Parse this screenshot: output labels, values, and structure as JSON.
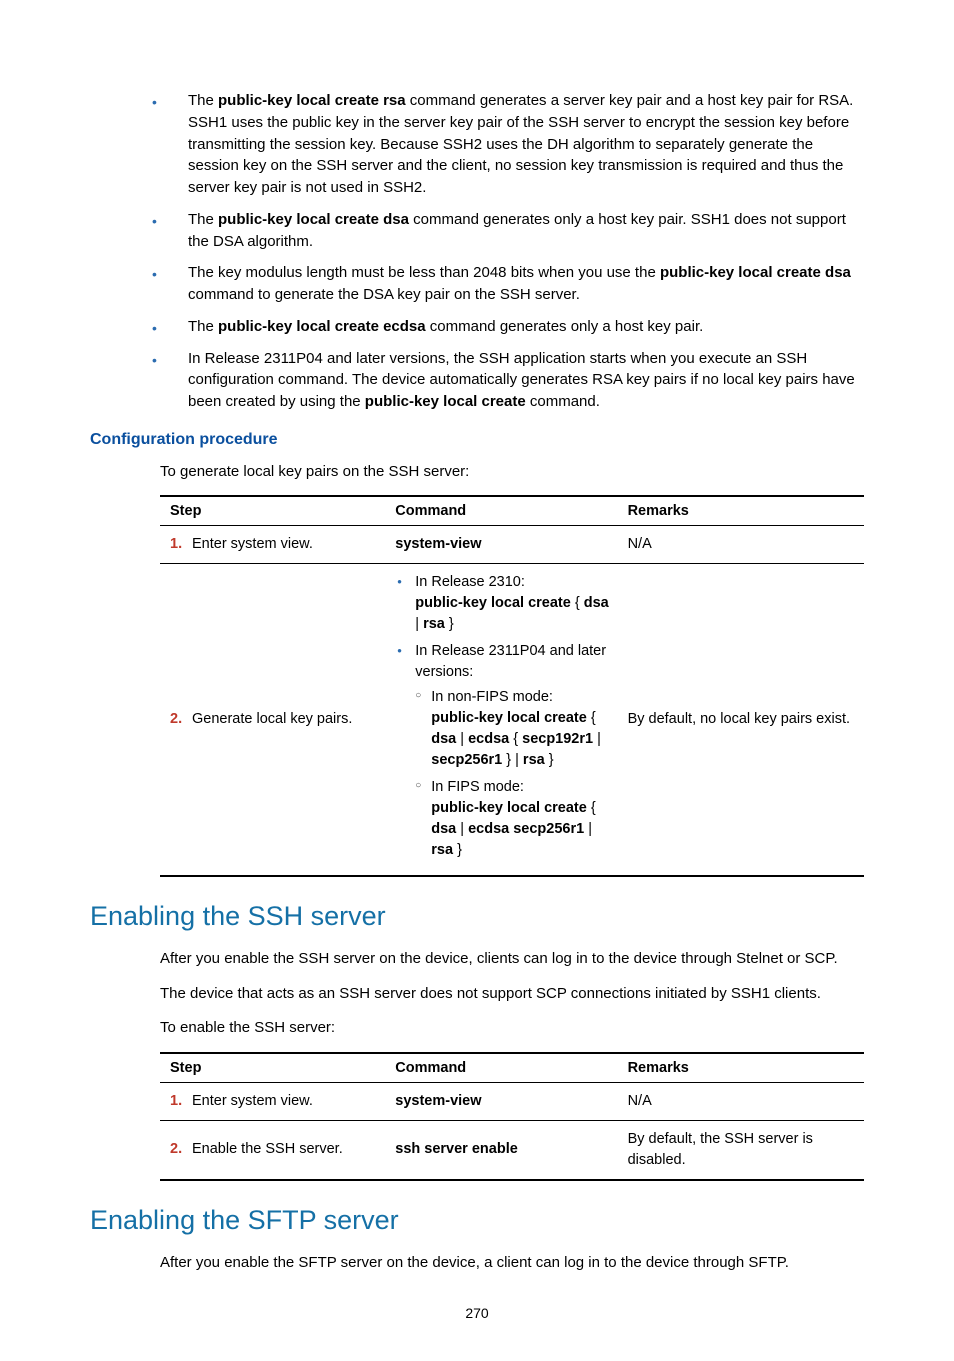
{
  "bullets": [
    {
      "pre": "The ",
      "bold": "public-key local create rsa",
      "post": " command generates a server key pair and a host key pair for RSA. SSH1 uses the public key in the server key pair of the SSH server to encrypt the session key before transmitting the session key. Because SSH2 uses the DH algorithm to separately generate the session key on the SSH server and the client, no session key transmission is required and thus the server key pair is not used in SSH2."
    },
    {
      "pre": "The ",
      "bold": "public-key local create dsa",
      "post": " command generates only a host key pair. SSH1 does not support the DSA algorithm."
    },
    {
      "pre": "The key modulus length must be less than 2048 bits when you use the ",
      "bold": "public-key local create dsa",
      "post": " command to generate the DSA key pair on the SSH server."
    },
    {
      "pre": "The ",
      "bold": "public-key local create ecdsa",
      "post": " command generates only a host key pair."
    },
    {
      "pre": "In Release 2311P04 and later versions, the SSH application starts when you execute an SSH configuration command. The device automatically generates RSA key pairs if no local key pairs have been created by using the ",
      "bold": "public-key local create",
      "post": " command."
    }
  ],
  "config_procedure_title": "Configuration procedure",
  "config_intro": "To generate local key pairs on the SSH server:",
  "table1": {
    "headers": {
      "step": "Step",
      "command": "Command",
      "remarks": "Remarks"
    },
    "rows": [
      {
        "num": "1.",
        "step": "Enter system view.",
        "cmd_bold": "system-view",
        "remarks": "N/A"
      },
      {
        "num": "2.",
        "step": "Generate local key pairs.",
        "remarks": "By default, no local key pairs exist.",
        "cmd_list": [
          {
            "intro": "In Release 2310:",
            "bolds": [
              "public-key local create",
              " { ",
              "dsa",
              " | ",
              "rsa",
              " }"
            ]
          },
          {
            "intro": "In Release 2311P04 and later versions:",
            "sub": [
              {
                "label": "In non-FIPS mode:",
                "line": [
                  "public-key local create",
                  " { ",
                  "dsa",
                  " | ",
                  "ecdsa",
                  " { ",
                  "secp192r1",
                  " | ",
                  "secp256r1",
                  " } | ",
                  "rsa",
                  " }"
                ]
              },
              {
                "label": "In FIPS mode:",
                "line": [
                  "public-key local create",
                  " { ",
                  "dsa",
                  " | ",
                  "ecdsa secp256r1",
                  " | ",
                  "rsa",
                  " }"
                ]
              }
            ]
          }
        ]
      }
    ]
  },
  "sec_ssh_title": "Enabling the SSH server",
  "sec_ssh_p1": "After you enable the SSH server on the device, clients can log in to the device through Stelnet or SCP.",
  "sec_ssh_p2": "The device that acts as an SSH server does not support SCP connections initiated by SSH1 clients.",
  "sec_ssh_p3": "To enable the SSH server:",
  "table2": {
    "headers": {
      "step": "Step",
      "command": "Command",
      "remarks": "Remarks"
    },
    "rows": [
      {
        "num": "1.",
        "step": "Enter system view.",
        "cmd_bold": "system-view",
        "remarks": "N/A"
      },
      {
        "num": "2.",
        "step": "Enable the SSH server.",
        "cmd_bold": "ssh server enable",
        "remarks": "By default, the SSH server is disabled."
      }
    ]
  },
  "sec_sftp_title": "Enabling the SFTP server",
  "sec_sftp_p1": "After you enable the SFTP server on the device, a client can log in to the device through SFTP.",
  "page_num": "270"
}
